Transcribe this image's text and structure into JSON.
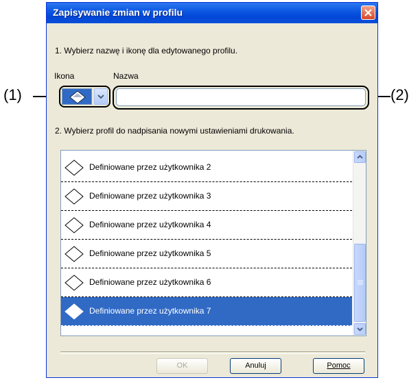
{
  "dialog": {
    "title": "Zapisywanie zmian w profilu",
    "step1": "1. Wybierz nazwę i ikonę dla edytowanego profilu.",
    "icon_label": "Ikona",
    "name_label": "Nazwa",
    "name_value": "",
    "step2": "2. Wybierz profil do nadpisania nowymi ustawieniami drukowania.",
    "profiles": [
      "Definiowane przez użytkownika 2",
      "Definiowane przez użytkownika 3",
      "Definiowane przez użytkownika 4",
      "Definiowane przez użytkownika 5",
      "Definiowane przez użytkownika 6",
      "Definiowane przez użytkownika 7"
    ],
    "selected_profile": "Definiowane przez użytkownika 7",
    "buttons": {
      "ok": "OK",
      "cancel": "Anuluj",
      "help": "Pomoc"
    }
  },
  "callouts": {
    "left": "(1)",
    "right": "(2)"
  },
  "colors": {
    "titlebar": "#0a55e0",
    "selection": "#316ac5",
    "face": "#ece9d8"
  }
}
